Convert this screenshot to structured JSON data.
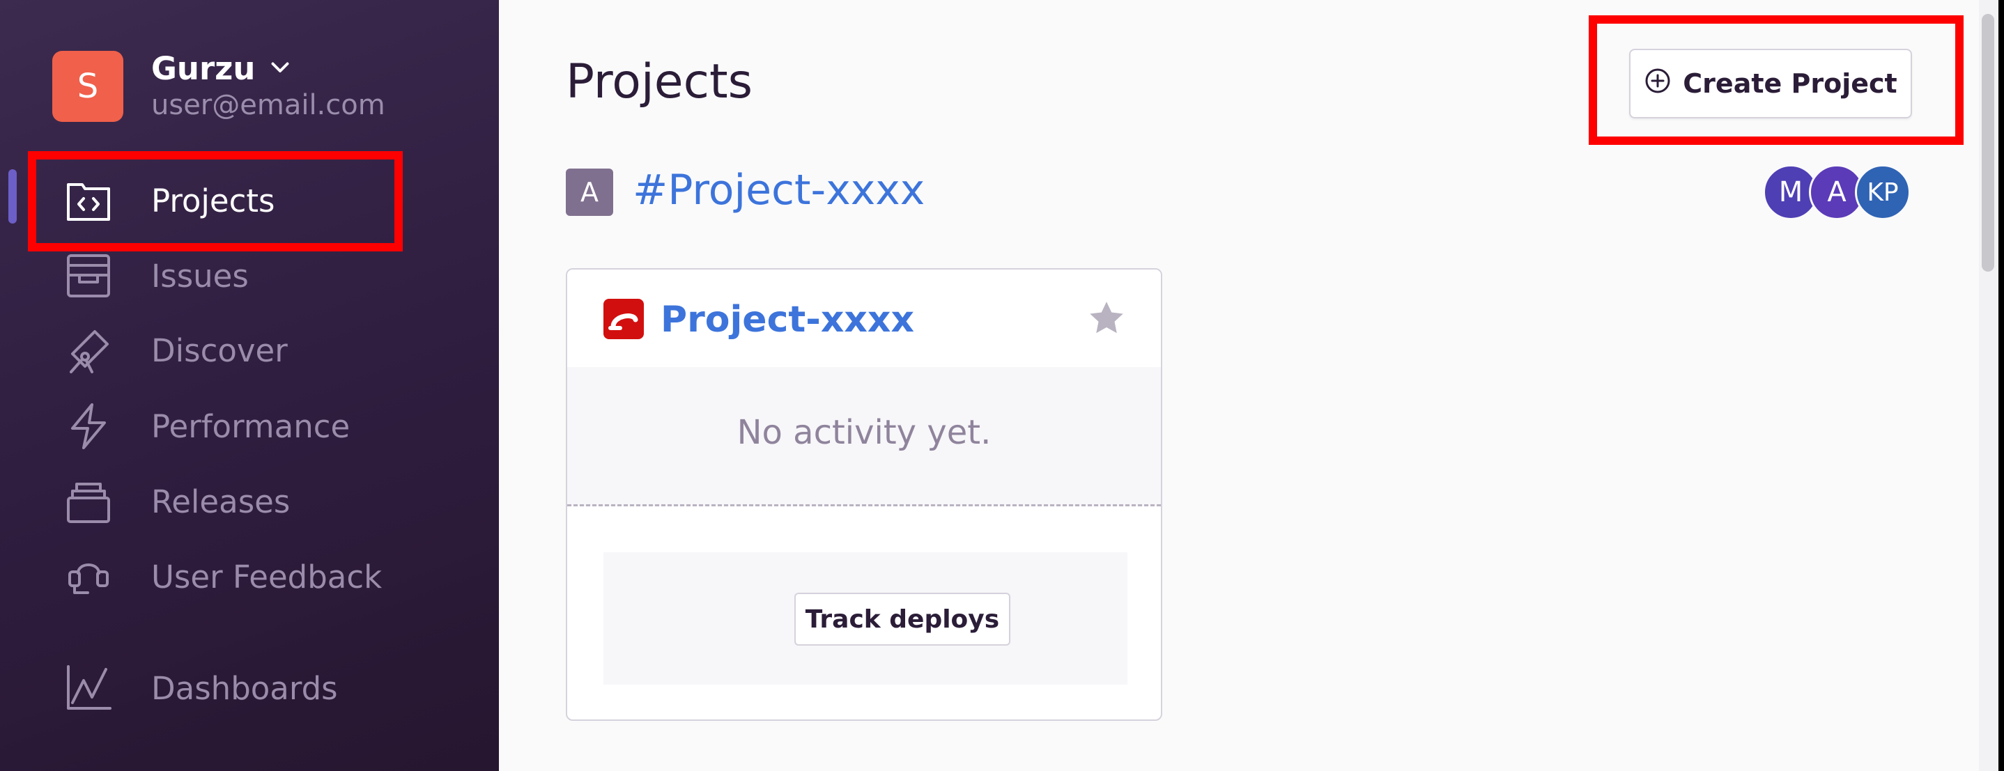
{
  "org": {
    "avatar_letter": "S",
    "name": "Gurzu",
    "email": "user@email.com"
  },
  "sidebar": {
    "items": [
      {
        "label": "Projects",
        "icon": "projects-icon",
        "active": true
      },
      {
        "label": "Issues",
        "icon": "issues-icon",
        "active": false
      },
      {
        "label": "Discover",
        "icon": "discover-icon",
        "active": false
      },
      {
        "label": "Performance",
        "icon": "performance-icon",
        "active": false
      },
      {
        "label": "Releases",
        "icon": "releases-icon",
        "active": false
      },
      {
        "label": "User Feedback",
        "icon": "user-feedback-icon",
        "active": false
      },
      {
        "label": "Dashboards",
        "icon": "dashboards-icon",
        "active": false
      }
    ]
  },
  "main": {
    "title": "Projects",
    "create_button": "Create Project",
    "team": {
      "badge": "A",
      "name": "#Project-xxxx",
      "members": [
        "M",
        "A",
        "KP"
      ]
    },
    "project_card": {
      "name": "Project-xxxx",
      "activity_text": "No activity yet.",
      "track_button": "Track deploys"
    }
  },
  "colors": {
    "accent": "#3d74db",
    "highlight": "#ff0000",
    "org_avatar": "#f0604a",
    "member_avatars": [
      "#4e3fb4",
      "#5b3bb8",
      "#2f63b4"
    ]
  }
}
